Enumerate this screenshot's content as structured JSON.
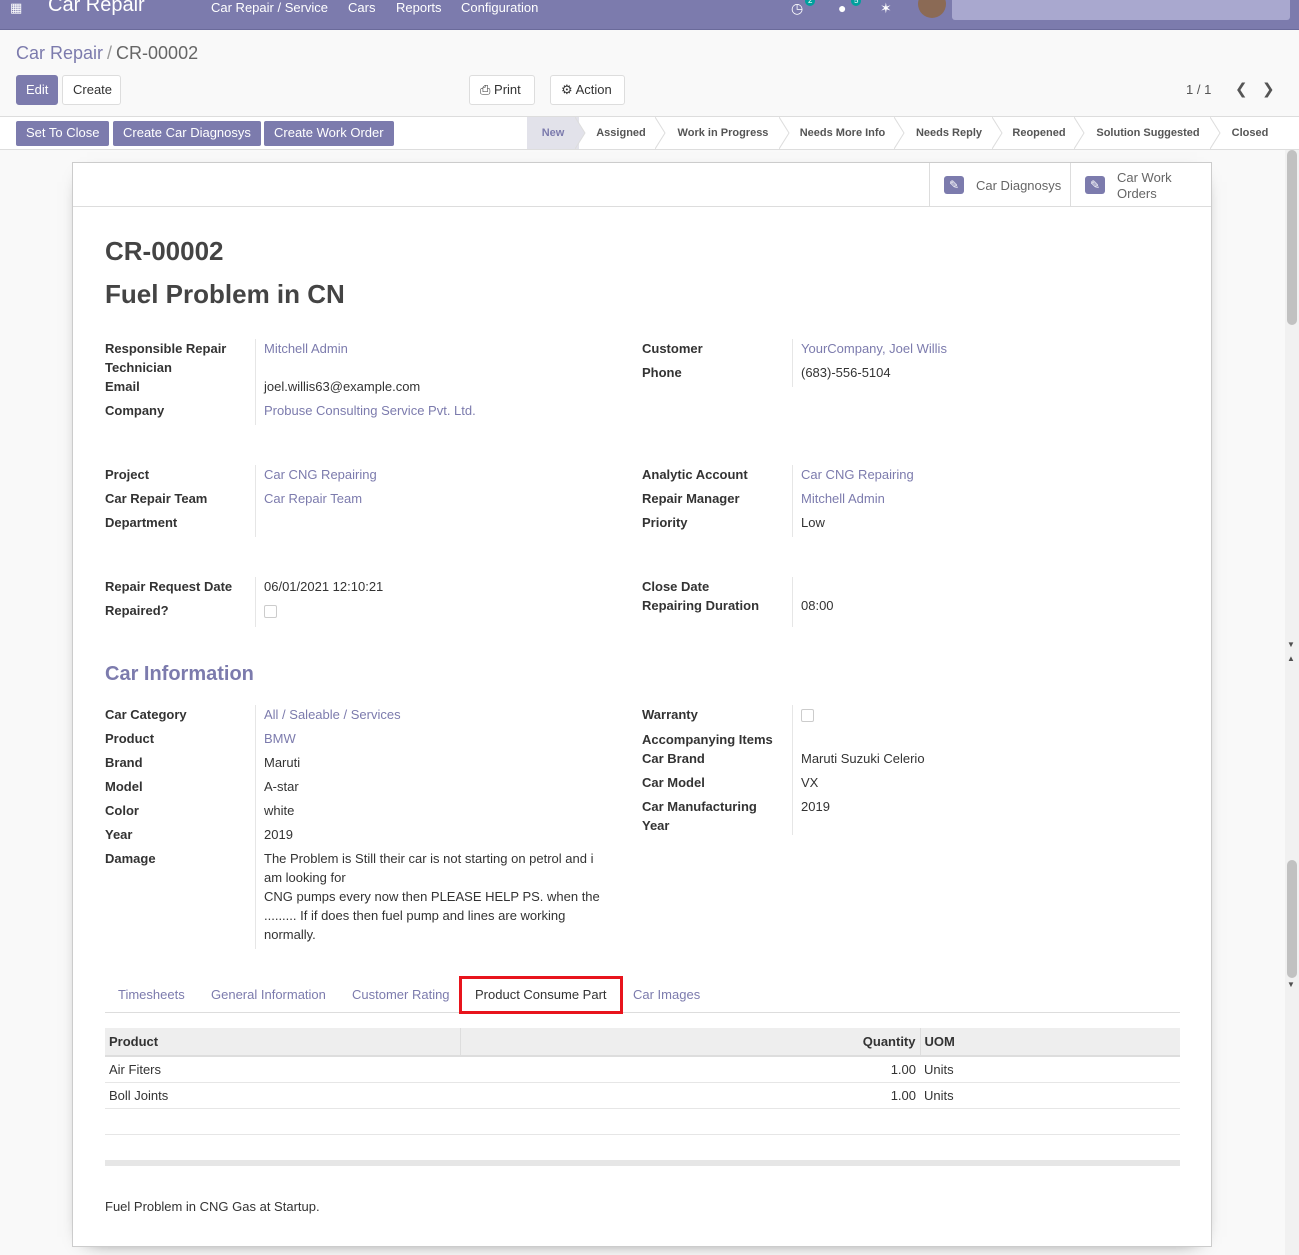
{
  "navbar": {
    "app_name": "Car Repair",
    "menu": [
      "Car Repair / Service",
      "Cars",
      "Reports",
      "Configuration"
    ],
    "activity_badge": "2",
    "messages_badge": "5"
  },
  "breadcrumb": {
    "parent": "Car Repair",
    "current": "CR-00002"
  },
  "buttons": {
    "edit": "Edit",
    "create": "Create",
    "print": "Print",
    "action": "Action"
  },
  "pager": "1 / 1",
  "status_buttons": [
    "Set To Close",
    "Create Car Diagnosys",
    "Create Work Order"
  ],
  "stages": [
    "New",
    "Assigned",
    "Work in Progress",
    "Needs More Info",
    "Needs Reply",
    "Reopened",
    "Solution Suggested",
    "Closed"
  ],
  "active_stage": "New",
  "smart_buttons": {
    "diagnosys": "Car Diagnosys",
    "work_orders_1": "Car Work",
    "work_orders_2": "Orders"
  },
  "record": {
    "name": "CR-00002",
    "title": "Fuel Problem in CN"
  },
  "group1": {
    "technician_label_1": "Responsible Repair",
    "technician_label_2": "Technician",
    "technician": "Mitchell Admin",
    "email_label": "Email",
    "email": "joel.willis63@example.com",
    "company_label": "Company",
    "company": "Probuse Consulting Service Pvt. Ltd.",
    "customer_label": "Customer",
    "customer": "YourCompany, Joel Willis",
    "phone_label": "Phone",
    "phone": "(683)-556-5104"
  },
  "group2": {
    "project_label": "Project",
    "project": "Car CNG Repairing",
    "team_label": "Car Repair Team",
    "team": "Car Repair Team",
    "department_label": "Department",
    "analytic_label": "Analytic Account",
    "analytic": "Car CNG Repairing",
    "manager_label": "Repair Manager",
    "manager": "Mitchell Admin",
    "priority_label": "Priority",
    "priority": "Low"
  },
  "group3": {
    "request_date_label": "Repair Request Date",
    "request_date": "06/01/2021 12:10:21",
    "repaired_label": "Repaired?",
    "close_date_label": "Close Date",
    "duration_label": "Repairing Duration",
    "duration": "08:00"
  },
  "car_info": {
    "section_title": "Car Information",
    "category_label": "Car Category",
    "category": "All / Saleable / Services",
    "product_label": "Product",
    "product": "BMW",
    "brand_label": "Brand",
    "brand": "Maruti",
    "model_label": "Model",
    "model": "A-star",
    "color_label": "Color",
    "color": "white",
    "year_label": "Year",
    "year": "2019",
    "damage_label": "Damage",
    "damage_1": "The Problem is Still their car is not starting on petrol and i",
    "damage_2": "am looking for",
    "damage_3": "CNG pumps every now then PLEASE HELP PS. when the",
    "damage_4": "......... If if does then fuel pump and lines are working",
    "damage_5": "normally.",
    "warranty_label": "Warranty",
    "accompanying_label": "Accompanying Items",
    "car_brand_label": "Car Brand",
    "car_brand": "Maruti Suzuki Celerio",
    "car_model_label": "Car Model",
    "car_model": "VX",
    "mfg_year_label_1": "Car Manufacturing",
    "mfg_year_label_2": "Year",
    "mfg_year": "2019"
  },
  "tabs": [
    "Timesheets",
    "General Information",
    "Customer Rating",
    "Product Consume Part",
    "Car Images"
  ],
  "active_tab": "Product Consume Part",
  "parts_table": {
    "headers": [
      "Product",
      "Quantity",
      "UOM"
    ],
    "rows": [
      [
        "Air Fiters",
        "1.00",
        "Units"
      ],
      [
        "Boll Joints",
        "1.00",
        "Units"
      ]
    ]
  },
  "note": "Fuel Problem in CNG Gas at Startup.",
  "colors": {
    "brand": "#7c7bad",
    "highlight": "#e8141c"
  }
}
